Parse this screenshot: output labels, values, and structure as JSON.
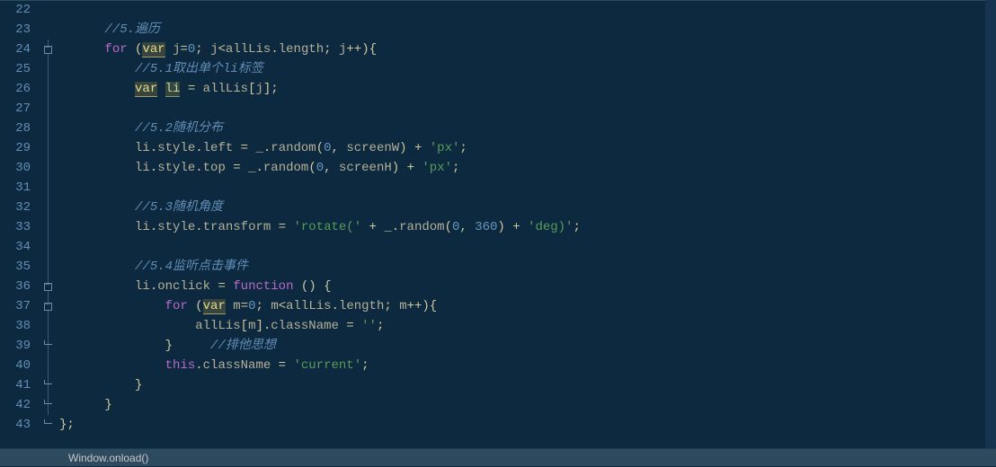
{
  "chart_data": null,
  "statusbar": {
    "context": "Window.onload()"
  },
  "gutter": {
    "start": 22,
    "end": 43
  },
  "code": {
    "l22": {
      "indent": ""
    },
    "l23": {
      "comment": "//5.遍历"
    },
    "l24": {
      "kw_for": "for",
      "kw_var": "var",
      "id_j": "j",
      "n0": "0",
      "id_allLis": "allLis",
      "id_len": "length",
      "id_j2": "j"
    },
    "l25": {
      "comment": "//5.1取出单个li标签"
    },
    "l26": {
      "kw_var": "var",
      "id_li": "li",
      "id_allLis": "allLis",
      "id_j": "j"
    },
    "l27": {
      "blank": ""
    },
    "l28": {
      "comment": "//5.2随机分布"
    },
    "l29": {
      "id_li": "li",
      "id_style": "style",
      "id_left": "left",
      "id_us": "_",
      "id_random": "random",
      "n0": "0",
      "id_sw": "screenW",
      "str": "'px'"
    },
    "l30": {
      "id_li": "li",
      "id_style": "style",
      "id_top": "top",
      "id_us": "_",
      "id_random": "random",
      "n0": "0",
      "id_sh": "screenH",
      "str": "'px'"
    },
    "l31": {
      "blank": ""
    },
    "l32": {
      "comment": "//5.3随机角度"
    },
    "l33": {
      "id_li": "li",
      "id_style": "style",
      "id_tf": "transform",
      "str1": "'rotate('",
      "id_us": "_",
      "id_random": "random",
      "n0": "0",
      "n360": "360",
      "str2": "'deg)'"
    },
    "l34": {
      "blank": ""
    },
    "l35": {
      "comment": "//5.4监听点击事件"
    },
    "l36": {
      "id_li": "li",
      "id_onclick": "onclick",
      "kw_fn": "function"
    },
    "l37": {
      "kw_for": "for",
      "kw_var": "var",
      "id_m": "m",
      "n0": "0",
      "id_allLis": "allLis",
      "id_len": "length",
      "id_m2": "m"
    },
    "l38": {
      "id_allLis": "allLis",
      "id_m": "m",
      "id_cls": "className",
      "str": "''"
    },
    "l39": {
      "comment": "//排他思想"
    },
    "l40": {
      "kw_this": "this",
      "id_cls": "className",
      "str": "'current'"
    },
    "l41": {
      "blank": ""
    },
    "l42": {
      "blank": ""
    },
    "l43": {
      "blank": ""
    }
  }
}
